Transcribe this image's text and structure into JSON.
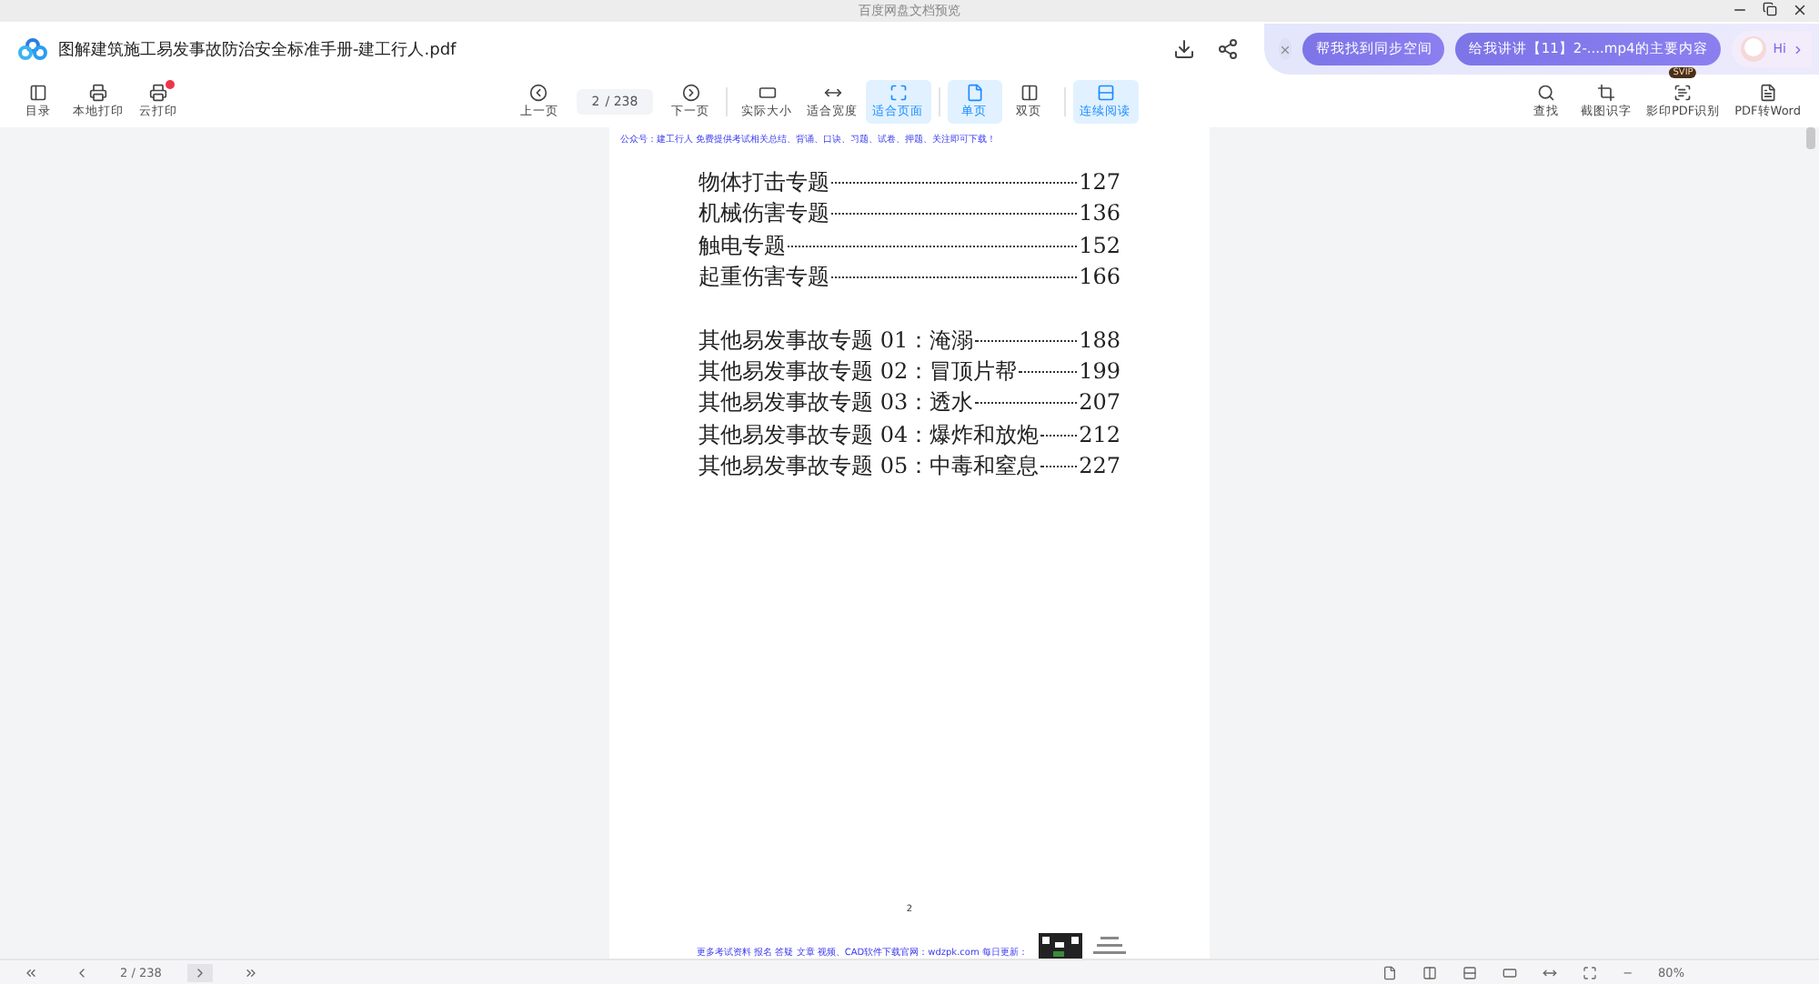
{
  "window": {
    "title": "百度网盘文档预览"
  },
  "file": {
    "name": "图解建筑施工易发事故防治安全标准手册-建工行人.pdf"
  },
  "assistant": {
    "suggestions": [
      "帮我找到同步空间",
      "给我讲讲【11】2-....mp4的主要内容"
    ],
    "greeting": "Hi"
  },
  "toolbar": {
    "left": [
      {
        "label": "目录",
        "notify": false
      },
      {
        "label": "本地打印",
        "notify": false
      },
      {
        "label": "云打印",
        "notify": true
      }
    ],
    "prev": "上一页",
    "page": "2",
    "total": "/ 238",
    "next": "下一页",
    "view_groups": [
      [
        {
          "label": "实际大小",
          "selected": false
        },
        {
          "label": "适合宽度",
          "selected": false
        },
        {
          "label": "适合页面",
          "selected": true
        }
      ],
      [
        {
          "label": "单页",
          "selected": true
        },
        {
          "label": "双页",
          "selected": false
        }
      ],
      [
        {
          "label": "连续阅读",
          "selected": true
        }
      ]
    ],
    "right": [
      {
        "label": "查找"
      },
      {
        "label": "截图识字"
      },
      {
        "label": "影印PDF识别",
        "badge": "SVIP"
      },
      {
        "label": "PDF转Word"
      }
    ]
  },
  "document": {
    "header_note": "公众号：建工行人 免费提供考试相关总结、背诵、口诀、习题、试卷、押题、关注即可下载！",
    "toc_groups": [
      [
        {
          "title": "物体打击专题",
          "page": "127"
        },
        {
          "title": "机械伤害专题",
          "page": "136"
        },
        {
          "title": "触电专题",
          "page": "152"
        },
        {
          "title": "起重伤害专题",
          "page": "166"
        }
      ],
      [
        {
          "title": "其他易发事故专题 01：淹溺",
          "page": "188"
        },
        {
          "title": "其他易发事故专题 02：冒顶片帮",
          "page": "199"
        },
        {
          "title": "其他易发事故专题 03：透水",
          "page": "207"
        },
        {
          "title": "其他易发事故专题 04：爆炸和放炮",
          "page": "212"
        },
        {
          "title": "其他易发事故专题 05：中毒和窒息",
          "page": "227"
        }
      ]
    ],
    "page_number": "2",
    "footer_note": "更多考试资料 报名 答疑 文章 视频、CAD软件下载官网：wdzpk.com 每日更新："
  },
  "status_bar": {
    "page": "2",
    "total": "/ 238",
    "zoom_out": "−",
    "zoom": "80%"
  }
}
